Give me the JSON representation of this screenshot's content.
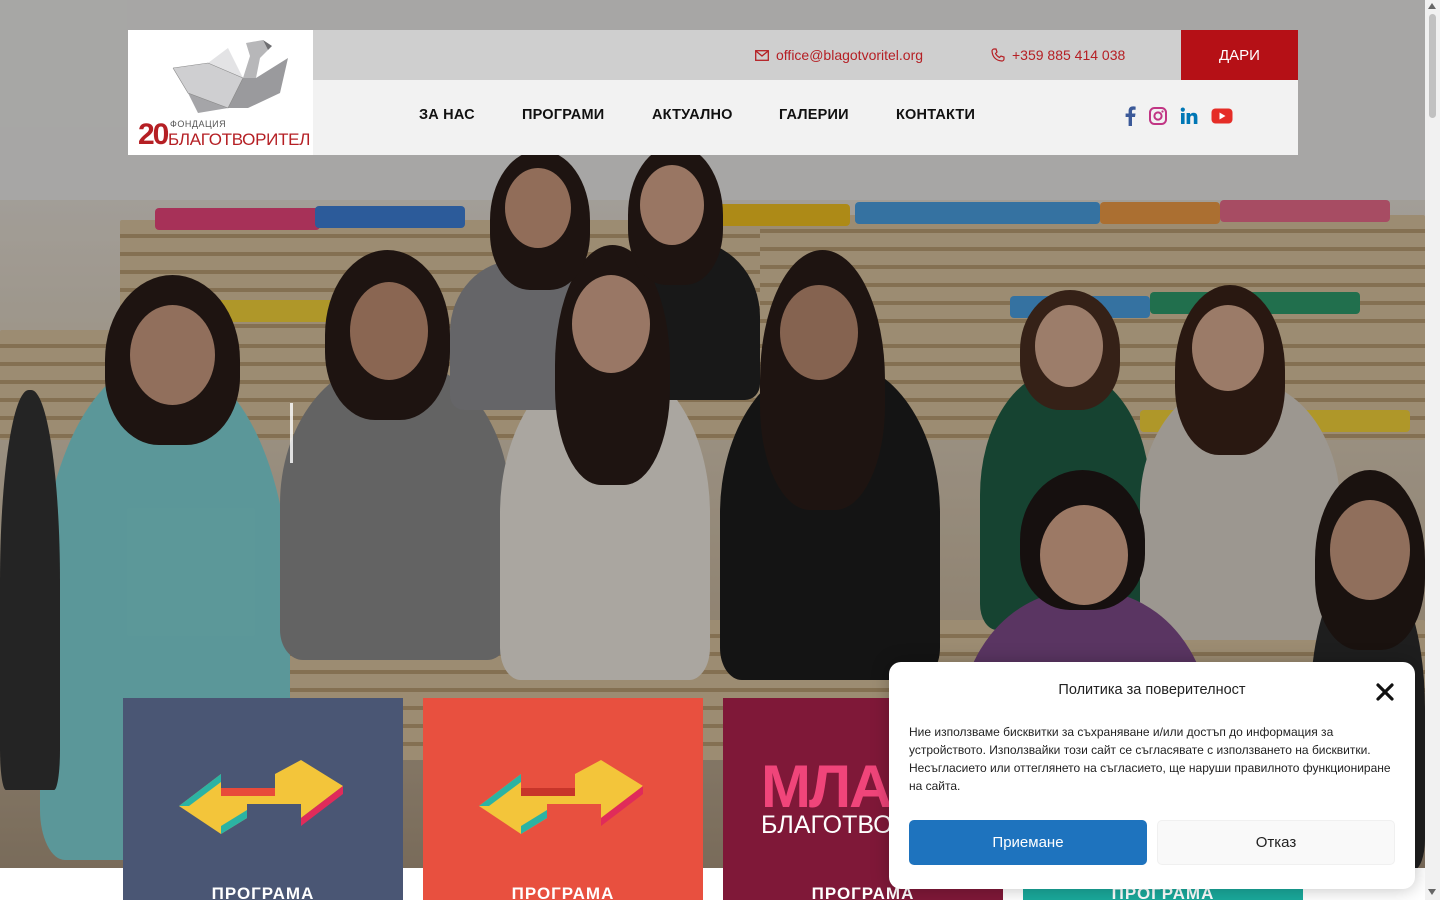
{
  "header": {
    "logo": {
      "years": "20",
      "foundation_label": "ФОНДАЦИЯ",
      "name": "БЛАГОТВОРИТЕЛ"
    },
    "email": "office@blagotvoritel.org",
    "phone": "+359 885 414 038",
    "donate_label": "ДАРИ",
    "nav": [
      "ЗА НАС",
      "ПРОГРАМИ",
      "АКТУАЛНО",
      "ГАЛЕРИИ",
      "КОНТАКТИ"
    ],
    "social_icons": [
      "facebook-icon",
      "instagram-icon",
      "linkedin-icon",
      "youtube-icon"
    ]
  },
  "cards": [
    {
      "title": "ПРОГРАМА",
      "color": "#4a5674"
    },
    {
      "title": "ПРОГРАМА",
      "color": "#e8503f"
    },
    {
      "title": "ПРОГРАМА",
      "color": "#7f1838",
      "logo_text_1": "МЛА",
      "logo_text_2": "БЛАГОТВО"
    },
    {
      "title": "ПРОГРАМА",
      "color": "#1aa99b"
    }
  ],
  "cookie_dialog": {
    "title": "Политика за поверителност",
    "text": "Ние използваме бисквитки за съхраняване и/или достъп до информация за устройството. Използвайки този сайт се съгласявате с използването на бисквитки. Несъгласието или оттеглянето на съгласието, ще наруши правилното функциониране на сайта.",
    "accept_label": "Приемане",
    "deny_label": "Отказ"
  },
  "colors": {
    "brand_red": "#b51016",
    "accept_blue": "#1e73be"
  }
}
